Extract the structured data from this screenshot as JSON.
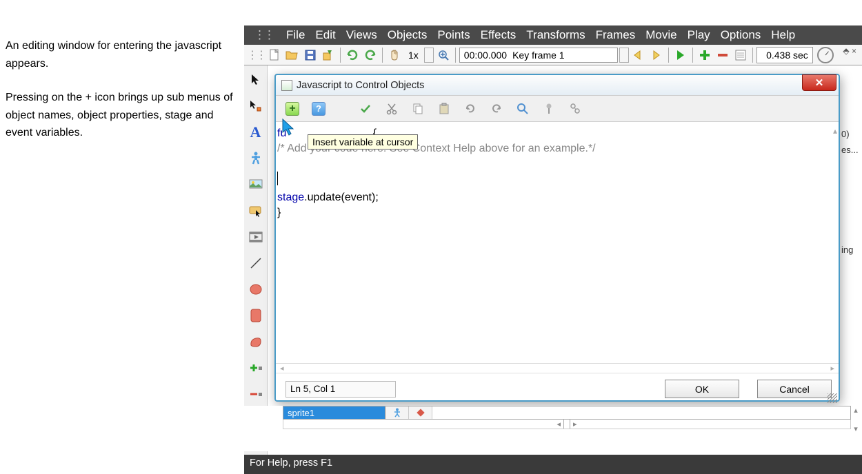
{
  "description": {
    "para1": "An editing window for entering the javascript appears.",
    "para2": "Pressing on the + icon brings up sub menus of object names, object properties, stage and event variables."
  },
  "menubar": {
    "file": "File",
    "edit": "Edit",
    "views": "Views",
    "objects": "Objects",
    "points": "Points",
    "effects": "Effects",
    "transforms": "Transforms",
    "frames": "Frames",
    "movie": "Movie",
    "play": "Play",
    "options": "Options",
    "help": "Help"
  },
  "toolbar": {
    "zoom": "1x",
    "frame_time": "00:00.000",
    "frame_label": "Key frame 1",
    "duration": "0.438 sec"
  },
  "dialog": {
    "title": "Javascript to Control Objects",
    "tooltip": "Insert variable at cursor",
    "code_func_brace": " {",
    "code_func_prefix": "fu",
    "code_comment": "/* Add your code here. See Context Help above for an example.*/",
    "code_stage": "stage",
    "code_update": ".update(event);",
    "code_close": "}",
    "cursor_pos": "Ln 5, Col 1",
    "ok": "OK",
    "cancel": "Cancel"
  },
  "timeline": {
    "sprite_name": "sprite1"
  },
  "right_fragments": {
    "f1": "0)",
    "f2": "es...",
    "f3": "ing"
  },
  "pin_label": "⬘ ×",
  "statusbar": "For Help, press F1"
}
